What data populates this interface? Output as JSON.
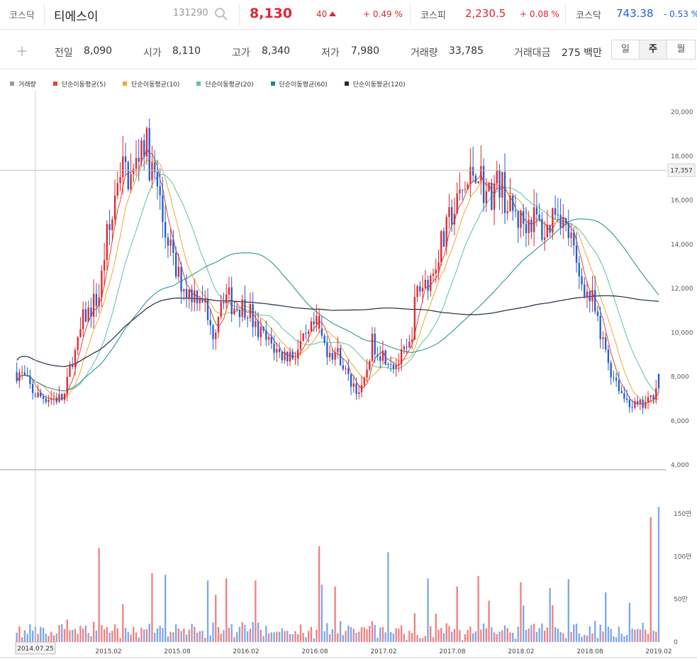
{
  "header": {
    "market_label": "코스닥",
    "stock_name": "티에스이",
    "stock_code": "131290",
    "price": "8,130",
    "change": "40",
    "change_pct": "+ 0.49 %",
    "kospi_label": "코스피",
    "kospi_value": "2,230.5",
    "kospi_change": "+ 0.08 %",
    "kosdaq_label": "코스닥",
    "kosdaq_value": "743.38",
    "kosdaq_change": "- 0.53 %",
    "search_icon": "search-icon",
    "up_icon": "triangle-up-icon"
  },
  "info": {
    "add_icon": "plus-icon",
    "prev_label": "전일",
    "prev_value": "8,090",
    "open_label": "시가",
    "open_value": "8,110",
    "high_label": "고가",
    "high_value": "8,340",
    "low_label": "저가",
    "low_value": "7,980",
    "volume_label": "거래량",
    "volume_value": "33,785",
    "amount_label": "거래대금",
    "amount_value": "275 백만",
    "periods": [
      "일",
      "주",
      "월"
    ],
    "active_period": "주"
  },
  "colors": {
    "up": "#e0262f",
    "down": "#1f5fd0",
    "vol_up": "#f08080",
    "vol_down": "#7da7e8"
  },
  "chart_data": {
    "type": "candlestick",
    "legend": [
      {
        "name": "거래량",
        "color": "#999999"
      },
      {
        "name": "단순이동평균(5)",
        "color": "#e8452f"
      },
      {
        "name": "단순이동평균(10)",
        "color": "#f0a830"
      },
      {
        "name": "단순이동평균(20)",
        "color": "#5cc2a0"
      },
      {
        "name": "단순이동평균(60)",
        "color": "#1c8c88"
      },
      {
        "name": "단순이동평균(120)",
        "color": "#1f2a44"
      }
    ],
    "price_axis": {
      "ticks": [
        4000,
        6000,
        8000,
        10000,
        12000,
        14000,
        16000,
        18000,
        20000
      ],
      "tick_labels": [
        "4,000",
        "6,000",
        "8,000",
        "10,000",
        "12,000",
        "14,000",
        "16,000",
        "18,000",
        "20,000"
      ],
      "range": [
        4000,
        20000
      ]
    },
    "volume_axis": {
      "ticks": [
        0,
        50,
        100,
        150
      ],
      "tick_labels": [
        "0",
        "50만",
        "100만",
        "150만"
      ],
      "range": [
        0,
        160
      ],
      "unit": "만"
    },
    "x_labels": [
      "2015.02",
      "2015.08",
      "2016.02",
      "2016.08",
      "2017.02",
      "2017.08",
      "2018.02",
      "2018.08",
      "2019.02"
    ],
    "crosshair": {
      "price": 17357,
      "price_label": "17,357",
      "date": "2014.07.25"
    },
    "price_anchors": [
      [
        "2014.06",
        8200
      ],
      [
        "2014.08",
        7100
      ],
      [
        "2014.10",
        7000
      ],
      [
        "2014.11",
        9000
      ],
      [
        "2014.12",
        10800
      ],
      [
        "2015.01",
        11500
      ],
      [
        "2015.02",
        14500
      ],
      [
        "2015.03",
        17500
      ],
      [
        "2015.04",
        17000
      ],
      [
        "2015.05",
        18800
      ],
      [
        "2015.06",
        17000
      ],
      [
        "2015.07",
        14500
      ],
      [
        "2015.08",
        12500
      ],
      [
        "2015.09",
        11800
      ],
      [
        "2015.10",
        11800
      ],
      [
        "2015.11",
        10000
      ],
      [
        "2015.12",
        11800
      ],
      [
        "2016.01",
        11200
      ],
      [
        "2016.02",
        11200
      ],
      [
        "2016.03",
        10000
      ],
      [
        "2016.04",
        9500
      ],
      [
        "2016.05",
        9000
      ],
      [
        "2016.06",
        9000
      ],
      [
        "2016.07",
        9500
      ],
      [
        "2016.08",
        10300
      ],
      [
        "2016.09",
        9300
      ],
      [
        "2016.10",
        9000
      ],
      [
        "2016.11",
        7800
      ],
      [
        "2016.12",
        7300
      ],
      [
        "2017.01",
        9500
      ],
      [
        "2017.02",
        9000
      ],
      [
        "2017.03",
        8600
      ],
      [
        "2017.04",
        9100
      ],
      [
        "2017.05",
        12000
      ],
      [
        "2017.06",
        12500
      ],
      [
        "2017.07",
        14000
      ],
      [
        "2017.08",
        15500
      ],
      [
        "2017.09",
        16500
      ],
      [
        "2017.10",
        17500
      ],
      [
        "2017.11",
        16200
      ],
      [
        "2017.12",
        16800
      ],
      [
        "2018.01",
        15500
      ],
      [
        "2018.02",
        15000
      ],
      [
        "2018.03",
        15200
      ],
      [
        "2018.04",
        14500
      ],
      [
        "2018.05",
        15800
      ],
      [
        "2018.06",
        14500
      ],
      [
        "2018.07",
        12500
      ],
      [
        "2018.08",
        11500
      ],
      [
        "2018.09",
        9500
      ],
      [
        "2018.10",
        8000
      ],
      [
        "2018.11",
        7000
      ],
      [
        "2018.12",
        6600
      ],
      [
        "2019.01",
        6800
      ],
      [
        "2019.02",
        8100
      ]
    ]
  }
}
